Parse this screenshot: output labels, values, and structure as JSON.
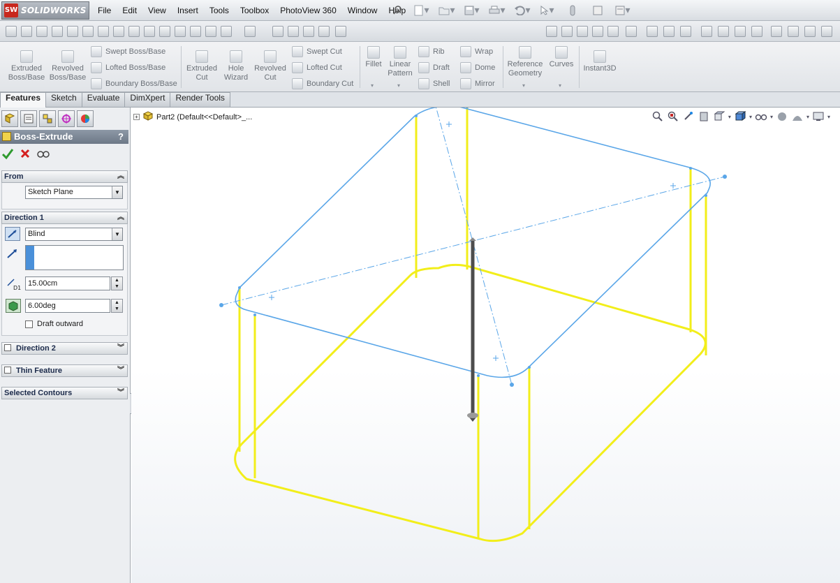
{
  "app": {
    "logo_mark": "SW",
    "logo_text": "SOLIDWORKS"
  },
  "menu": [
    "File",
    "Edit",
    "View",
    "Insert",
    "Tools",
    "Toolbox",
    "PhotoView 360",
    "Window",
    "Help"
  ],
  "quick_access_icons": [
    "new-icon",
    "open-icon",
    "save-icon",
    "print-icon",
    "undo-icon",
    "select-icon",
    "rebuild-icon",
    "file-properties-icon",
    "options-icon"
  ],
  "command_manager": {
    "extruded_boss": [
      "Extruded",
      "Boss/Base"
    ],
    "revolved_boss": [
      "Revolved",
      "Boss/Base"
    ],
    "swept_boss": "Swept Boss/Base",
    "lofted_boss": "Lofted Boss/Base",
    "boundary_boss": "Boundary Boss/Base",
    "extruded_cut": [
      "Extruded",
      "Cut"
    ],
    "hole_wizard": [
      "Hole",
      "Wizard"
    ],
    "revolved_cut": [
      "Revolved",
      "Cut"
    ],
    "swept_cut": "Swept Cut",
    "lofted_cut": "Lofted Cut",
    "boundary_cut": "Boundary Cut",
    "fillet": "Fillet",
    "linear_pattern": [
      "Linear",
      "Pattern"
    ],
    "rib": "Rib",
    "draft": "Draft",
    "shell": "Shell",
    "wrap": "Wrap",
    "dome": "Dome",
    "mirror": "Mirror",
    "reference_geometry": [
      "Reference",
      "Geometry"
    ],
    "curves": "Curves",
    "instant3d": "Instant3D"
  },
  "tabs": [
    "Features",
    "Sketch",
    "Evaluate",
    "DimXpert",
    "Render Tools"
  ],
  "active_tab": "Features",
  "property_manager": {
    "title": "Boss-Extrude",
    "help": "?",
    "from": {
      "label": "From",
      "value": "Sketch Plane"
    },
    "direction1": {
      "label": "Direction 1",
      "end_condition": "Blind",
      "depth": "15.00cm",
      "draft_angle": "6.00deg",
      "draft_outward_label": "Draft outward",
      "draft_outward": false,
      "depth_label": "D1"
    },
    "direction2": {
      "label": "Direction 2",
      "checked": false
    },
    "thin_feature": {
      "label": "Thin Feature",
      "checked": false
    },
    "selected_contours": {
      "label": "Selected Contours"
    }
  },
  "tree": {
    "root": "Part2  (Default<<Default>_..."
  },
  "colors": {
    "preview_yellow": "#f2ee1a",
    "sketch_blue": "#5aa6e8",
    "title_bar": "#7a8594",
    "arrow": "#555555"
  }
}
